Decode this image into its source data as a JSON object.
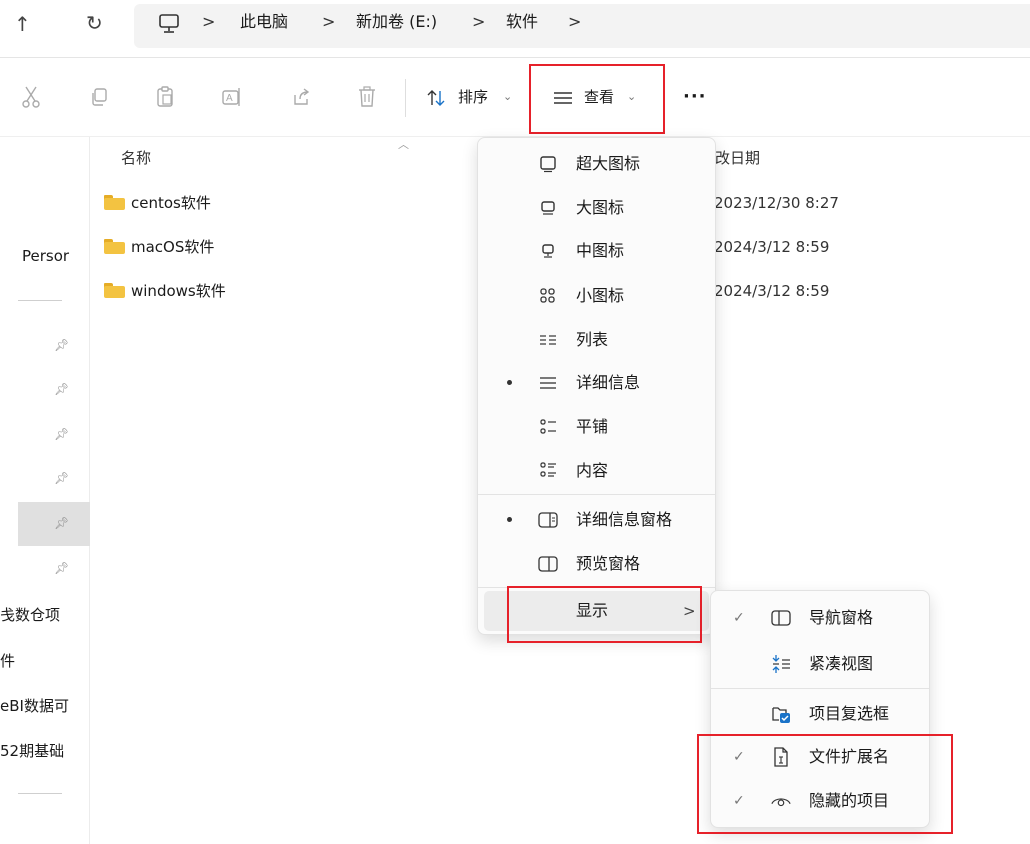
{
  "address_bar": {
    "crumbs": [
      "此电脑",
      "新加卷 (E:)",
      "软件"
    ],
    "separator": ">"
  },
  "nav_buttons": {
    "up_glyph": "↑",
    "refresh_glyph": "↻"
  },
  "command_bar": {
    "tools": [
      "cut-icon",
      "copy-icon",
      "paste-icon",
      "rename-icon",
      "share-icon",
      "delete-icon"
    ],
    "sort_label": "排序",
    "view_label": "查看",
    "more_glyph": "···"
  },
  "left_pane": {
    "items": [
      "Persor",
      "戋数仓项",
      "件",
      "eBI数据可",
      "52期基础"
    ],
    "pinned_count": 6,
    "selected_pin_index": 4
  },
  "file_list": {
    "columns": {
      "name": "名称",
      "date": "修改日期"
    },
    "rows": [
      {
        "name": "centos软件",
        "date": "2023/12/30 8:27"
      },
      {
        "name": "macOS软件",
        "date": "2024/3/12 8:59"
      },
      {
        "name": "windows软件",
        "date": "2024/3/12 8:59"
      }
    ]
  },
  "view_menu": {
    "items": [
      {
        "label": "超大图标",
        "icon": "extra-large-icons-icon",
        "active": false
      },
      {
        "label": "大图标",
        "icon": "large-icons-icon",
        "active": false
      },
      {
        "label": "中图标",
        "icon": "medium-icons-icon",
        "active": false
      },
      {
        "label": "小图标",
        "icon": "small-icons-icon",
        "active": false
      },
      {
        "label": "列表",
        "icon": "list-icon",
        "active": false
      },
      {
        "label": "详细信息",
        "icon": "details-icon",
        "active": true
      },
      {
        "label": "平铺",
        "icon": "tiles-icon",
        "active": false
      },
      {
        "label": "内容",
        "icon": "content-icon",
        "active": false
      }
    ],
    "pane_items": [
      {
        "label": "详细信息窗格",
        "icon": "details-pane-icon",
        "active": true
      },
      {
        "label": "预览窗格",
        "icon": "preview-pane-icon",
        "active": false
      }
    ],
    "show_label": "显示",
    "show_chevron": ">"
  },
  "show_submenu": {
    "items": [
      {
        "label": "导航窗格",
        "icon": "navigation-pane-icon",
        "checked": true
      },
      {
        "label": "紧凑视图",
        "icon": "compact-view-icon",
        "checked": false
      },
      {
        "label": "项目复选框",
        "icon": "item-checkbox-icon",
        "checked": false
      },
      {
        "label": "文件扩展名",
        "icon": "file-extension-icon",
        "checked": true
      },
      {
        "label": "隐藏的项目",
        "icon": "hidden-items-icon",
        "checked": true
      }
    ],
    "check_glyph": "✓"
  },
  "colors": {
    "highlight": "#e6212a",
    "folder": "#f3c341",
    "checkbox_blue": "#1a73c8"
  }
}
